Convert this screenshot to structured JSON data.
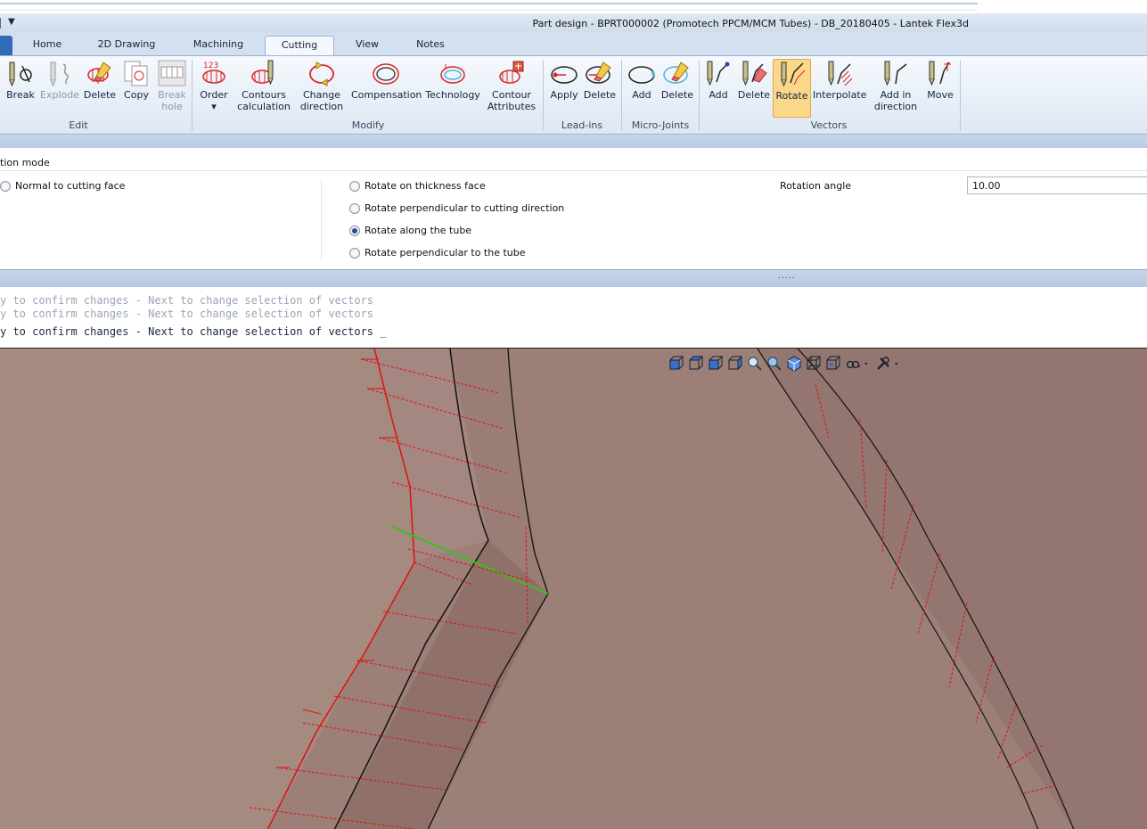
{
  "window": {
    "title": "Part design - BPRT000002 (Promotech PPCM/MCM Tubes) - DB_20180405 - Lantek Flex3d",
    "qat_icon": "dropdown-arrow-icon"
  },
  "tabs": [
    {
      "label": "Home"
    },
    {
      "label": "2D Drawing"
    },
    {
      "label": "Machining"
    },
    {
      "label": "Cutting"
    },
    {
      "label": "View"
    },
    {
      "label": "Notes"
    }
  ],
  "ribbon": {
    "groups": {
      "edit": "Edit",
      "modify": "Modify",
      "leadins": "Lead-ins",
      "microjoints": "Micro-Joints",
      "vectors": "Vectors"
    },
    "buttons": {
      "break": {
        "l1": "Break",
        "l2": ""
      },
      "explode": {
        "l1": "Explode",
        "l2": ""
      },
      "delete_edit": {
        "l1": "Delete",
        "l2": ""
      },
      "copy": {
        "l1": "Copy",
        "l2": ""
      },
      "break_hole": {
        "l1": "Break",
        "l2": "hole"
      },
      "order": {
        "l1": "Order",
        "l2": "▾"
      },
      "contours_calc": {
        "l1": "Contours",
        "l2": "calculation"
      },
      "change_dir": {
        "l1": "Change",
        "l2": "direction"
      },
      "compensation": {
        "l1": "Compensation",
        "l2": ""
      },
      "technology": {
        "l1": "Technology",
        "l2": ""
      },
      "contour_attr": {
        "l1": "Contour",
        "l2": "Attributes"
      },
      "apply": {
        "l1": "Apply",
        "l2": ""
      },
      "delete_leadin": {
        "l1": "Delete",
        "l2": ""
      },
      "add_mj": {
        "l1": "Add",
        "l2": ""
      },
      "delete_mj": {
        "l1": "Delete",
        "l2": ""
      },
      "add_vec": {
        "l1": "Add",
        "l2": ""
      },
      "delete_vec": {
        "l1": "Delete",
        "l2": ""
      },
      "rotate": {
        "l1": "Rotate",
        "l2": ""
      },
      "interpolate": {
        "l1": "Interpolate",
        "l2": ""
      },
      "add_in_dir": {
        "l1": "Add in",
        "l2": "direction"
      },
      "move": {
        "l1": "Move",
        "l2": ""
      }
    }
  },
  "panel": {
    "title": "tion mode",
    "left_option": {
      "label": "Normal to cutting face",
      "selected": false
    },
    "options": [
      {
        "label": "Rotate on thickness face",
        "selected": false
      },
      {
        "label": "Rotate perpendicular to cutting direction",
        "selected": false
      },
      {
        "label": "Rotate along the tube",
        "selected": true
      },
      {
        "label": "Rotate perpendicular to the tube",
        "selected": false
      }
    ],
    "rotation_angle_label": "Rotation angle",
    "rotation_angle_value": "10.00",
    "splitter_grip": "....."
  },
  "console": {
    "lines": [
      "y to confirm changes - Next to change selection of vectors",
      "y to confirm changes - Next to change selection of vectors",
      "y to confirm changes - Next to change selection of vectors _"
    ]
  },
  "viewport": {
    "background": "#9c8078",
    "toolbar_icons": [
      "view-front-icon",
      "view-top-icon",
      "view-left-icon",
      "view-right-icon",
      "zoom-window-icon",
      "zoom-icon",
      "view-iso-icon",
      "view-wire-icon",
      "view-box-icon",
      "orbit-icon",
      "tools-icon"
    ]
  }
}
